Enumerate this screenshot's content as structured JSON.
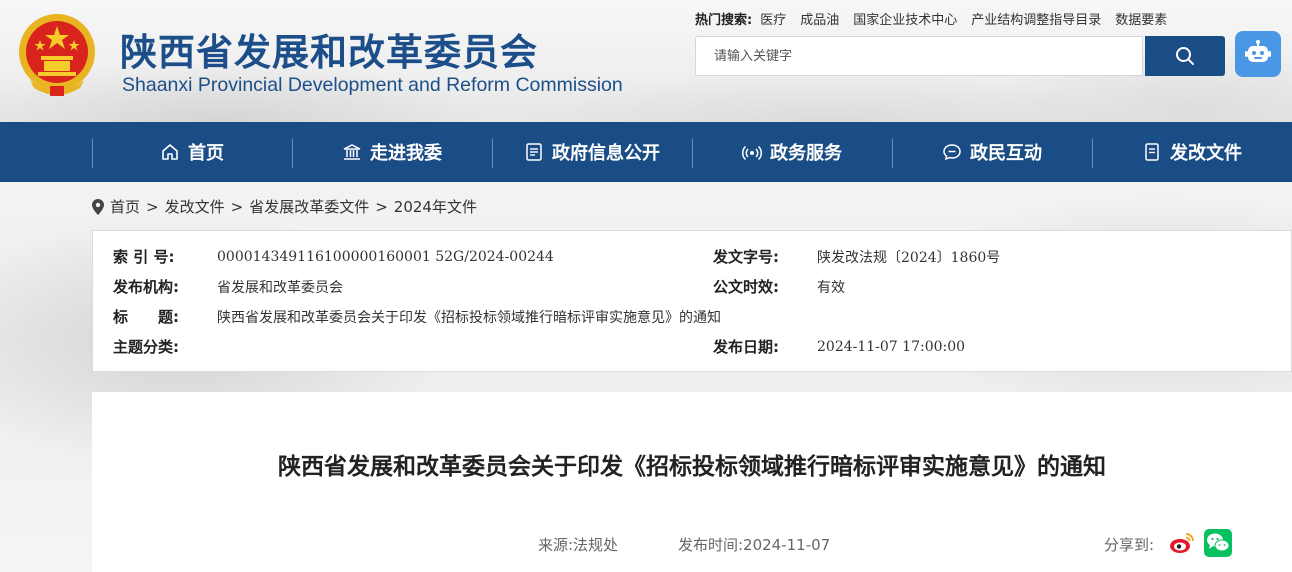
{
  "header": {
    "title_cn": "陕西省发展和改革委员会",
    "title_en": "Shaanxi Provincial Development and Reform Commission",
    "hot_search_label": "热门搜索:",
    "hot_links": [
      "医疗",
      "成品油",
      "国家企业技术中心",
      "产业结构调整指导目录",
      "数据要素"
    ],
    "search_placeholder": "请输入关键字"
  },
  "nav": {
    "items": [
      {
        "label": "首页",
        "icon": "home-icon"
      },
      {
        "label": "走进我委",
        "icon": "building-icon"
      },
      {
        "label": "政府信息公开",
        "icon": "document-list-icon"
      },
      {
        "label": "政务服务",
        "icon": "signal-icon"
      },
      {
        "label": "政民互动",
        "icon": "chat-icon"
      },
      {
        "label": "发改文件",
        "icon": "file-icon"
      }
    ]
  },
  "breadcrumb": [
    "首页",
    "发改文件",
    "省发展改革委文件",
    "2024年文件"
  ],
  "info": {
    "index_label": "索 引 号:",
    "index_value": "000014349116100000160001 52G/2024-00244",
    "doc_no_label": "发文字号:",
    "doc_no_value": "陕发改法规〔2024〕1860号",
    "publisher_label": "发布机构:",
    "publisher_value": "省发展和改革委员会",
    "validity_label": "公文时效:",
    "validity_value": "有效",
    "title_label": "标　　题:",
    "title_value": "陕西省发展和改革委员会关于印发《招标投标领域推行暗标评审实施意见》的通知",
    "topic_label": "主题分类:",
    "topic_value": "",
    "date_label": "发布日期:",
    "date_value": "2024-11-07 17:00:00"
  },
  "document": {
    "title": "陕西省发展和改革委员会关于印发《招标投标领域推行暗标评审实施意见》的通知",
    "source": "来源:法规处",
    "publish_time": "发布时间:2024-11-07",
    "share_label": "分享到:"
  },
  "colors": {
    "brand_blue": "#1a4d85",
    "robot_blue": "#4a97e6",
    "weibo_red": "#e6162d",
    "wechat_green": "#07c160"
  }
}
